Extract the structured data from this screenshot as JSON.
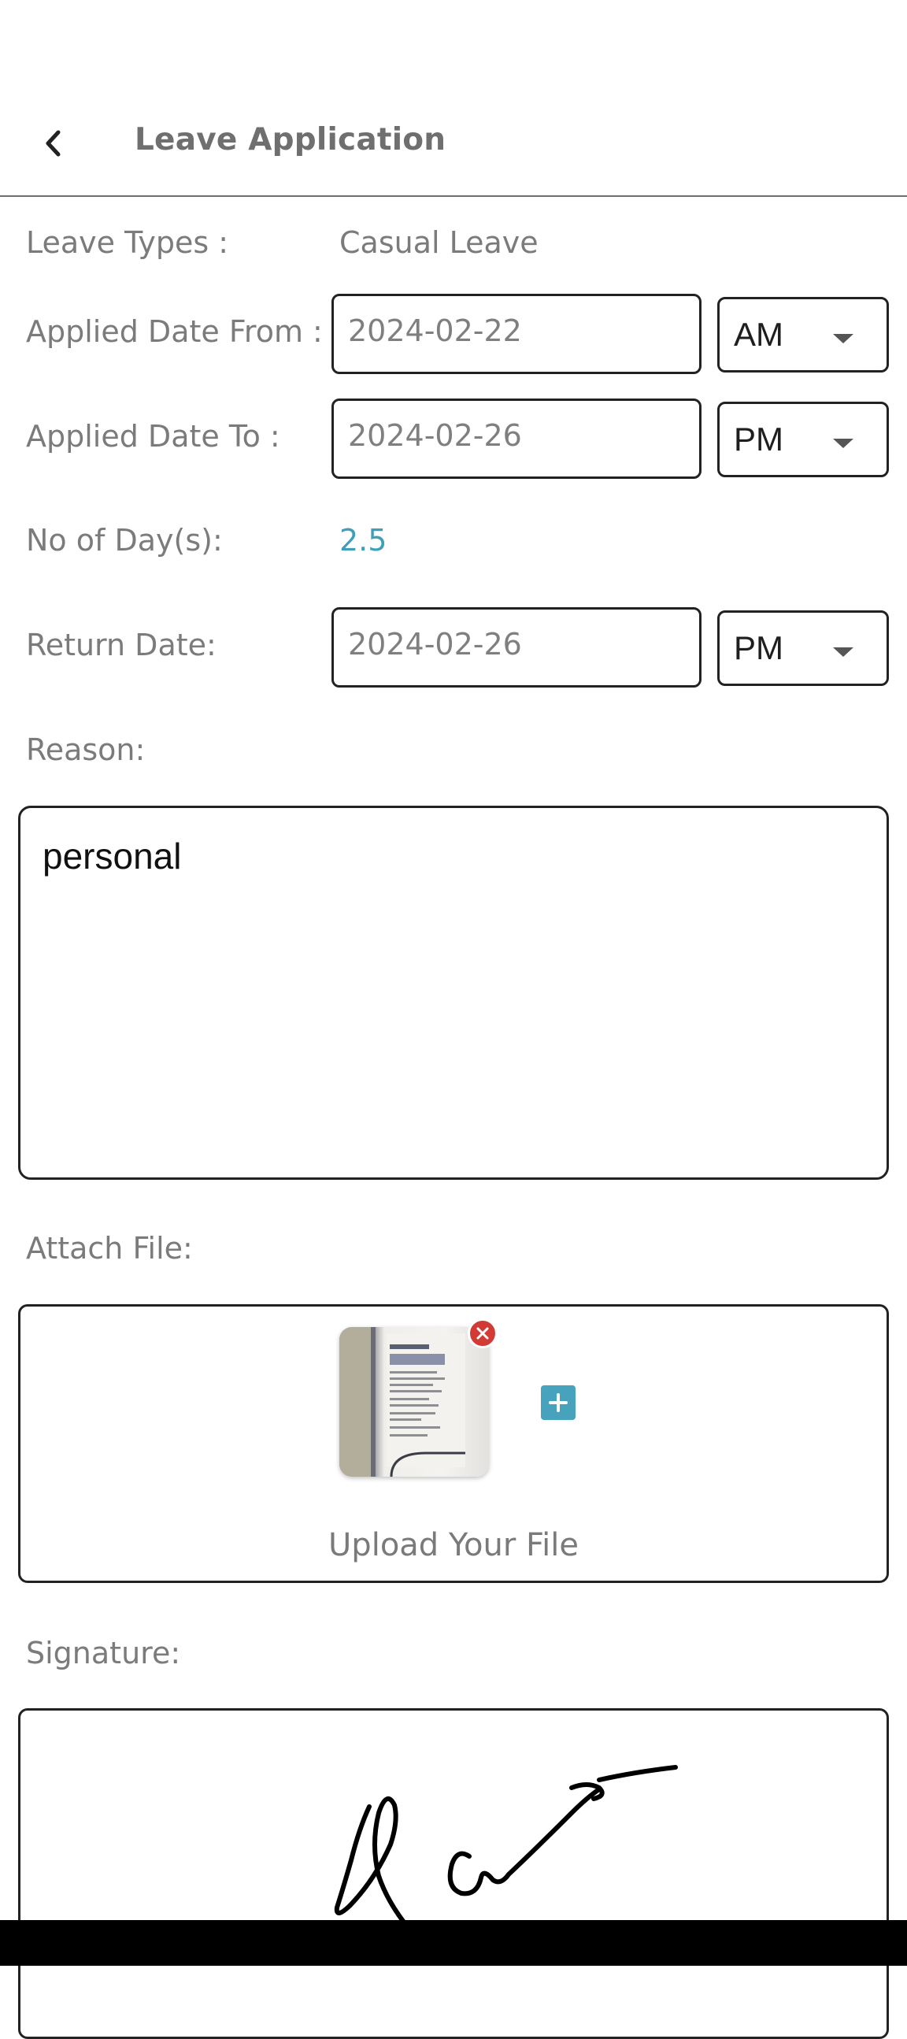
{
  "header": {
    "title": "Leave Application"
  },
  "form": {
    "leave_types_label": "Leave Types :",
    "leave_type_value": "Casual Leave",
    "date_from_label": "Applied Date From :",
    "date_from_value": "2024-02-22",
    "date_from_period": "AM",
    "date_to_label": "Applied Date To :",
    "date_to_value": "2024-02-26",
    "date_to_period": "PM",
    "days_label": "No of Day(s):",
    "days_value": "2.5",
    "return_label": "Return Date:",
    "return_value": "2024-02-26",
    "return_period": "PM",
    "reason_label": "Reason:",
    "reason_value": "personal",
    "attach_label": "Attach File:",
    "upload_label": "Upload Your File",
    "signature_label": "Signature:"
  },
  "colors": {
    "accent": "#3f9fb9",
    "remove": "#d23b35",
    "add": "#47a2bd"
  },
  "icons": {
    "back": "chevron-left-icon",
    "remove": "close-icon",
    "add": "plus-icon",
    "dropdown": "caret-down-icon"
  }
}
